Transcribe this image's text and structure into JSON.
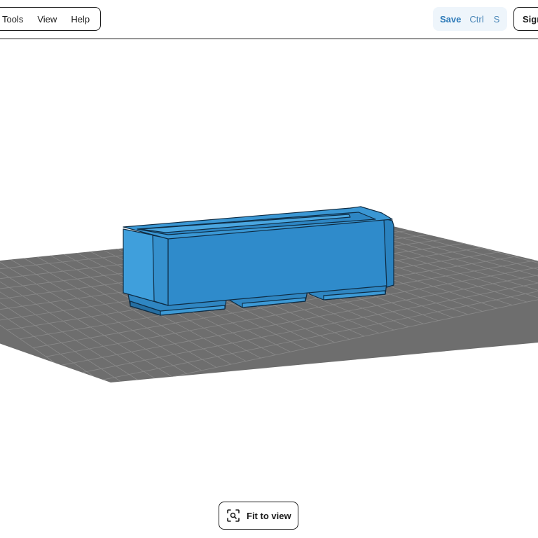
{
  "menu": {
    "items": [
      {
        "label": "Tools"
      },
      {
        "label": "View"
      },
      {
        "label": "Help"
      }
    ]
  },
  "toolbar": {
    "save_label": "Save",
    "shortcut_ctrl": "Ctrl",
    "shortcut_key": "S",
    "signin_label": "Sign"
  },
  "viewport": {
    "model_color": "#3a97d4",
    "grid_color": "#6e6e6e",
    "icons": [
      "fit-to-view-icon"
    ]
  },
  "fit_button": {
    "label": "Fit to view"
  }
}
